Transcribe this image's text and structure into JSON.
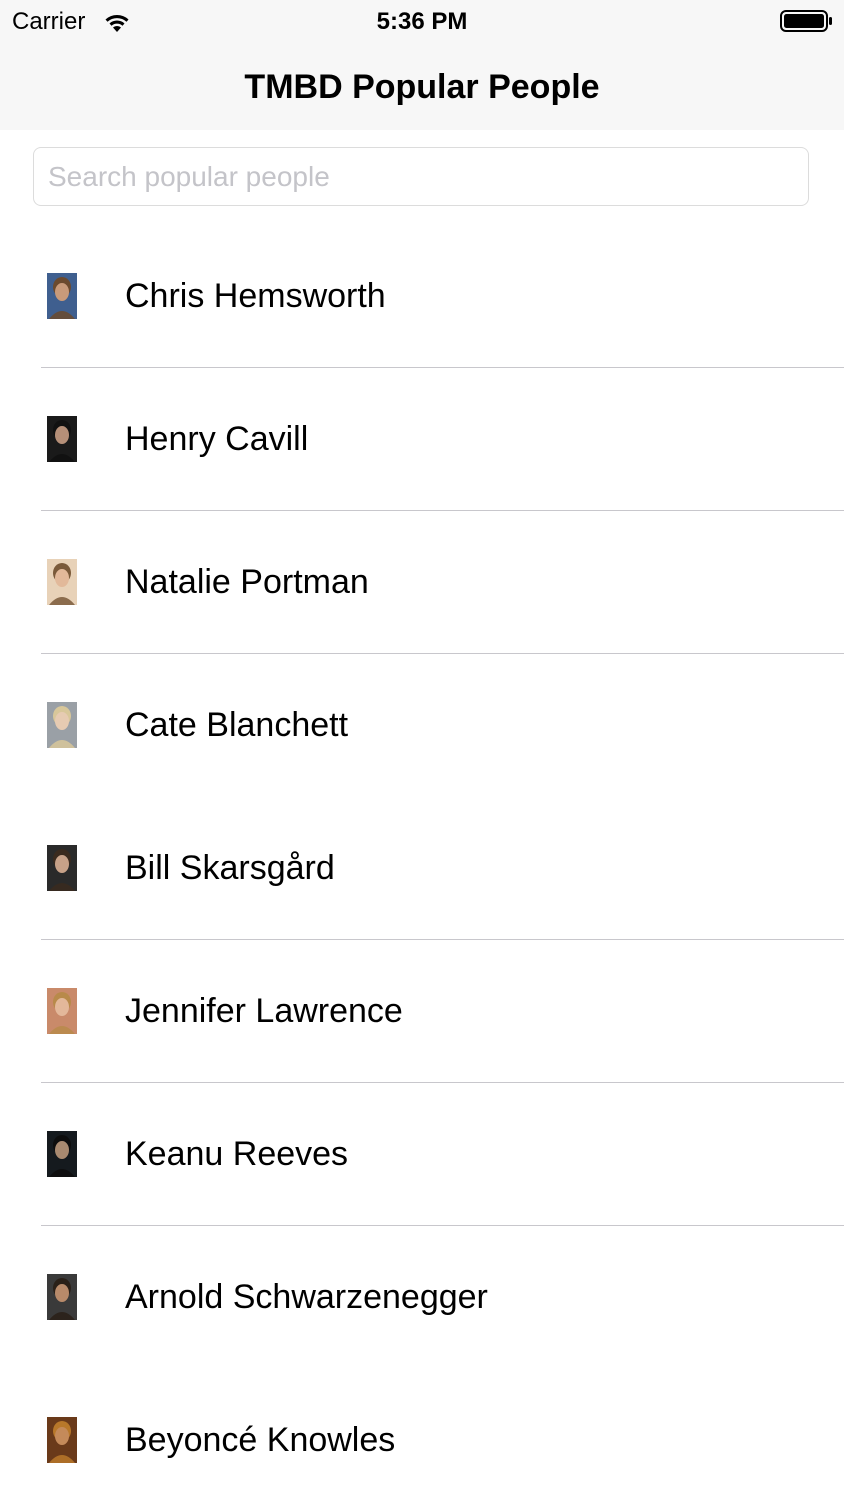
{
  "status_bar": {
    "carrier": "Carrier",
    "time": "5:36 PM",
    "wifi_icon": "wifi-icon",
    "battery_icon": "battery-icon"
  },
  "nav": {
    "title": "TMBD Popular People"
  },
  "search": {
    "placeholder": "Search popular people",
    "value": ""
  },
  "people": [
    {
      "name": "Chris Hemsworth",
      "bg": "#3f5f8f",
      "face": "#c89a7a",
      "hair": "#6b4a2e",
      "separator": true
    },
    {
      "name": "Henry Cavill",
      "bg": "#1a1a1a",
      "face": "#b58f78",
      "hair": "#111111",
      "separator": true
    },
    {
      "name": "Natalie Portman",
      "bg": "#e8d2b8",
      "face": "#e2b99a",
      "hair": "#7a5a3a",
      "separator": true
    },
    {
      "name": "Cate Blanchett",
      "bg": "#9aa0a6",
      "face": "#e6cbb2",
      "hair": "#d8c79a",
      "separator": false
    },
    {
      "name": "Bill Skarsgård",
      "bg": "#2a2a2a",
      "face": "#c7a188",
      "hair": "#3a2a1e",
      "separator": true
    },
    {
      "name": "Jennifer Lawrence",
      "bg": "#c98a6a",
      "face": "#e3b89a",
      "hair": "#b88a4a",
      "separator": true
    },
    {
      "name": "Keanu Reeves",
      "bg": "#151a1e",
      "face": "#a98a70",
      "hair": "#0d0d0d",
      "separator": true
    },
    {
      "name": "Arnold Schwarzenegger",
      "bg": "#3a3a3a",
      "face": "#b88a6a",
      "hair": "#2a2018",
      "separator": false
    },
    {
      "name": "Beyoncé Knowles",
      "bg": "#6a3a1a",
      "face": "#c48a5a",
      "hair": "#b8782a",
      "separator": false
    }
  ]
}
